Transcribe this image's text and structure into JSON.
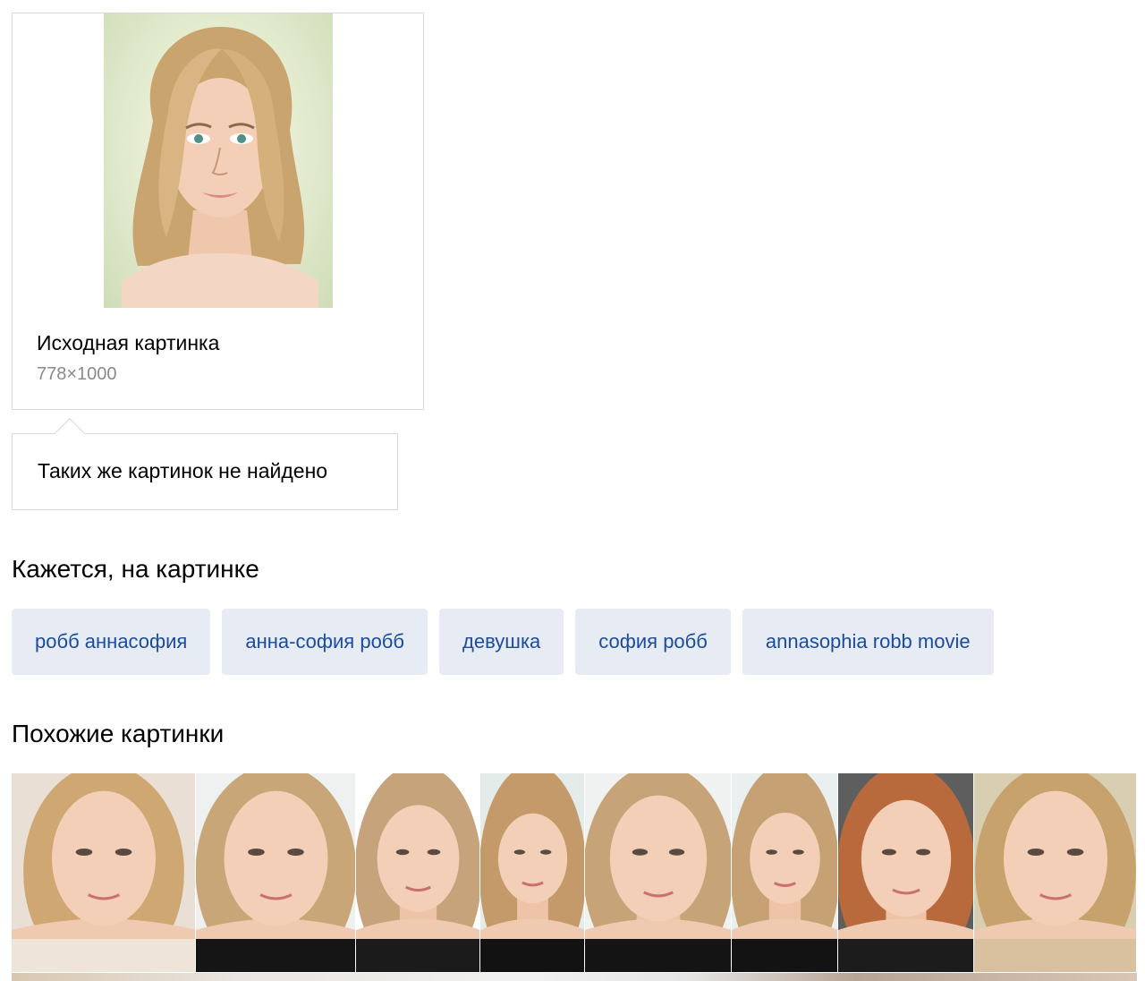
{
  "source": {
    "title": "Исходная картинка",
    "size": "778×1000"
  },
  "notfound": {
    "text": "Таких же картинок не найдено"
  },
  "tags_section": {
    "heading": "Кажется, на картинке",
    "tags": [
      "робб аннасофия",
      "анна-софия робб",
      "девушка",
      "софия робб",
      "annasophia robb movie"
    ]
  },
  "similar_section": {
    "heading": "Похожие картинки",
    "images": [
      {
        "name": "similar-image-1",
        "hair": "#cfa772",
        "bg": "#e9dfd4",
        "top": "#efe4d8"
      },
      {
        "name": "similar-image-2",
        "hair": "#c9a677",
        "bg": "#eef1ef",
        "top": "#151515"
      },
      {
        "name": "similar-image-3",
        "hair": "#c6a37a",
        "bg": "#ffffff",
        "top": "#1b1b1b"
      },
      {
        "name": "similar-image-4",
        "hair": "#c49a6b",
        "bg": "#e4ecea",
        "top": "#121212"
      },
      {
        "name": "similar-image-5",
        "hair": "#c7a477",
        "bg": "#f0f2f1",
        "top": "#141414"
      },
      {
        "name": "similar-image-6",
        "hair": "#c6a174",
        "bg": "#eaf0ef",
        "top": "#131313"
      },
      {
        "name": "similar-image-7",
        "hair": "#b86a3c",
        "bg": "#5e5e5e",
        "top": "#1c1c1c"
      },
      {
        "name": "similar-image-8",
        "hair": "#c7a26c",
        "bg": "#d8cfb3",
        "top": "#d9c09e"
      }
    ]
  }
}
